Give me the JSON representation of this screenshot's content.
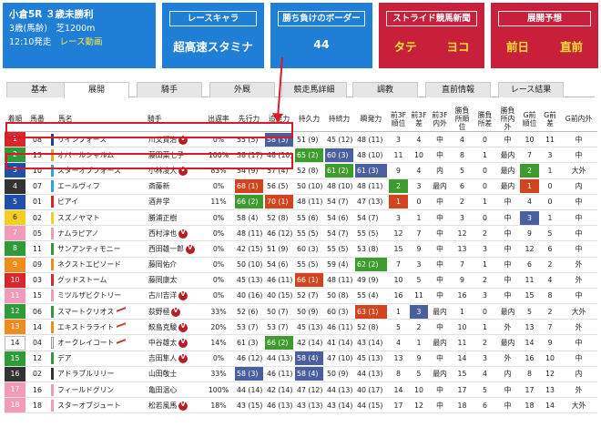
{
  "race": {
    "title": "小倉5R ３歳未勝利",
    "condition": "3歳(馬齢)　芝1200m",
    "time": "12:10発走",
    "video_link": "レース動画"
  },
  "chara": {
    "label": "レースキャラ",
    "value": "超高速スタミナ"
  },
  "border": {
    "label": "勝ち負けのボーダー",
    "value": "44"
  },
  "stride": {
    "label": "ストライド競馬新聞",
    "tate": "タテ",
    "yoko": "ヨコ"
  },
  "tenkai": {
    "label": "展開予想",
    "zenjitsu": "前日",
    "chokuzen": "直前"
  },
  "tabs": [
    "基本",
    "展開",
    "騎手",
    "外厩",
    "競走馬詳細",
    "調教",
    "直前情報",
    "レース結果"
  ],
  "active_tab": "展開",
  "columns": [
    "着順",
    "馬番",
    "馬名",
    "騎手",
    "出遅率",
    "先行力",
    "追走力",
    "持久力",
    "持続力",
    "瞬発力",
    "前3F順位",
    "前3F差",
    "前3F内外",
    "勝負所順位",
    "勝負所差",
    "勝負所内外",
    "G前順位",
    "G前差",
    "G前内外"
  ],
  "colors": {
    "panel_blue": "#1f7fd6",
    "panel_red": "#c8203a",
    "hl_red": "#d2431f",
    "hl_green": "#3e9b2d",
    "hl_blue": "#4a5f9e",
    "highlight_box": "#d81b2b"
  },
  "rows": [
    {
      "rank": "1",
      "waku": 3,
      "num": "08",
      "bar": "#1f3fa0",
      "name": "リインフォース",
      "jockey": "川又賢治",
      "mv": true,
      "dels": "0%",
      "senko": "55 (5)",
      "oiso": "58 (3)",
      "jikyu": "51 (9)",
      "jizoku": "45 (12)",
      "shunpatsu": "48 (11)",
      "f1": "3",
      "f2": "4",
      "f3": "中",
      "g1": "4",
      "g2": "0",
      "g3": "中",
      "h1": "10",
      "h2": "11",
      "h3": "中",
      "hl": {
        "oiso": "blue"
      }
    },
    {
      "rank": "2",
      "waku": 6,
      "num": "13",
      "bar": "#f0a020",
      "name": "オバールシャルム",
      "jockey": "藤田菜七子",
      "mv": false,
      "dels": "100%",
      "senko": "38 (17)",
      "oiso": "48 (10)",
      "jikyu": "65 (2)",
      "jizoku": "60 (3)",
      "shunpatsu": "48 (10)",
      "f1": "11",
      "f2": "10",
      "f3": "中",
      "g1": "8",
      "g2": "1",
      "g3": "最内",
      "h1": "7",
      "h2": "3",
      "h3": "中",
      "hl": {
        "jikyu": "green",
        "jizoku": "blue"
      }
    },
    {
      "rank": "3",
      "waku": 4,
      "num": "10",
      "bar": "#2aa4e0",
      "name": "スターオブフォース",
      "jockey": "小林凌大",
      "mv": true,
      "dels": "83%",
      "senko": "54 (9)",
      "oiso": "57 (4)",
      "jikyu": "52 (8)",
      "jizoku": "61 (2)",
      "shunpatsu": "61 (3)",
      "f1": "9",
      "f2": "4",
      "f3": "内",
      "g1": "5",
      "g2": "0",
      "g3": "最内",
      "h1": "2",
      "h2": "1",
      "h3": "大外",
      "hl": {
        "jizoku": "green",
        "shunpatsu": "blue",
        "h1": "green"
      }
    },
    {
      "rank": "4",
      "waku": 2,
      "num": "07",
      "bar": "#2aa4e0",
      "name": "エールヴィフ",
      "jockey": "斎藤新",
      "mv": false,
      "dels": "0%",
      "senko": "68 (1)",
      "oiso": "56 (5)",
      "jikyu": "50 (10)",
      "jizoku": "48 (10)",
      "shunpatsu": "48 (11)",
      "f1": "2",
      "f2": "3",
      "f3": "最内",
      "g1": "6",
      "g2": "0",
      "g3": "最内",
      "h1": "1",
      "h2": "0",
      "h3": "内",
      "hl": {
        "senko": "red",
        "f1": "green",
        "h1": "red"
      }
    },
    {
      "rank": "5",
      "waku": 4,
      "num": "01",
      "bar": "#d9262a",
      "name": "ピアイ",
      "jockey": "酒井学",
      "mv": false,
      "dels": "11%",
      "senko": "66 (2)",
      "oiso": "70 (1)",
      "jikyu": "48 (11)",
      "jizoku": "54 (7)",
      "shunpatsu": "47 (13)",
      "f1": "1",
      "f2": "0",
      "f3": "中",
      "g1": "2",
      "g2": "1",
      "g3": "中",
      "h1": "4",
      "h2": "0",
      "h3": "中",
      "hl": {
        "senko": "green",
        "oiso": "red",
        "f1": "red"
      }
    },
    {
      "rank": "6",
      "waku": 5,
      "num": "02",
      "bar": "#f3d01f",
      "name": "スズノヤマト",
      "jockey": "勝浦正樹",
      "mv": false,
      "dels": "0%",
      "senko": "58 (4)",
      "oiso": "52 (8)",
      "jikyu": "55 (6)",
      "jizoku": "54 (6)",
      "shunpatsu": "54 (7)",
      "f1": "3",
      "f2": "1",
      "f3": "中",
      "g1": "3",
      "g2": "0",
      "g3": "中",
      "h1": "3",
      "h2": "1",
      "h3": "中",
      "hl": {
        "h1": "blue"
      }
    },
    {
      "rank": "7",
      "waku": 8,
      "num": "05",
      "bar": "#f29bb8",
      "name": "ナムラピアノ",
      "jockey": "西村淳也",
      "mv": true,
      "dels": "0%",
      "senko": "48 (11)",
      "oiso": "46 (12)",
      "jikyu": "55 (5)",
      "jizoku": "54 (7)",
      "shunpatsu": "55 (5)",
      "f1": "12",
      "f2": "7",
      "f3": "中",
      "g1": "12",
      "g2": "2",
      "g3": "中",
      "h1": "9",
      "h2": "5",
      "h3": "中",
      "hl": {}
    },
    {
      "rank": "8",
      "waku": 6,
      "num": "11",
      "bar": "#2f9a38",
      "name": "サンアンティモニー",
      "jockey": "西田雄一郎",
      "mv": true,
      "dels": "0%",
      "senko": "42 (15)",
      "oiso": "51 (9)",
      "jikyu": "60 (3)",
      "jizoku": "55 (5)",
      "shunpatsu": "53 (8)",
      "f1": "15",
      "f2": "9",
      "f3": "中",
      "g1": "13",
      "g2": "3",
      "g3": "中",
      "h1": "12",
      "h2": "6",
      "h3": "中",
      "hl": {}
    },
    {
      "rank": "9",
      "waku": 7,
      "num": "09",
      "bar": "#f08c1e",
      "name": "ネクストエピソード",
      "jockey": "藤岡佑介",
      "mv": false,
      "dels": "0%",
      "senko": "50 (10)",
      "oiso": "54 (6)",
      "jikyu": "55 (5)",
      "jizoku": "59 (4)",
      "shunpatsu": "62 (2)",
      "f1": "7",
      "f2": "3",
      "f3": "中",
      "g1": "7",
      "g2": "1",
      "g3": "中",
      "h1": "6",
      "h2": "2",
      "h3": "外",
      "hl": {
        "shunpatsu": "green"
      }
    },
    {
      "rank": "10",
      "waku": 3,
      "num": "03",
      "bar": "#d9262a",
      "name": "グッドストーム",
      "jockey": "藤岡康太",
      "mv": false,
      "dels": "0%",
      "senko": "45 (13)",
      "oiso": "46 (11)",
      "jikyu": "66 (1)",
      "jizoku": "48 (11)",
      "shunpatsu": "49 (9)",
      "f1": "10",
      "f2": "5",
      "f3": "中",
      "g1": "9",
      "g2": "2",
      "g3": "中",
      "h1": "11",
      "h2": "4",
      "h3": "外",
      "hl": {
        "jikyu": "red"
      }
    },
    {
      "rank": "11",
      "waku": 8,
      "num": "15",
      "bar": "#f29bb8",
      "name": "ミツルザビクトリー",
      "jockey": "古川吉洋",
      "mv": true,
      "dels": "0%",
      "senko": "40 (16)",
      "oiso": "40 (15)",
      "jikyu": "52 (7)",
      "jizoku": "50 (8)",
      "shunpatsu": "55 (4)",
      "f1": "16",
      "f2": "11",
      "f3": "中",
      "g1": "16",
      "g2": "3",
      "g3": "中",
      "h1": "15",
      "h2": "8",
      "h3": "中",
      "hl": {}
    },
    {
      "rank": "12",
      "waku": 6,
      "num": "06",
      "bar": "#2f9a38",
      "name": "スマートクリオス",
      "jockey": "荻野極",
      "mv": true,
      "dels": "33%",
      "senko": "52 (6)",
      "oiso": "50 (7)",
      "jikyu": "50 (9)",
      "jizoku": "60 (3)",
      "shunpatsu": "63 (1)",
      "f1": "1",
      "f2": "3",
      "f3": "最内",
      "g1": "1",
      "g2": "0",
      "g3": "最内",
      "h1": "5",
      "h2": "2",
      "h3": "大外",
      "hl": {
        "shunpatsu": "red",
        "f2": "blue"
      },
      "arrow": true
    },
    {
      "rank": "13",
      "waku": 7,
      "num": "14",
      "bar": "#f08c1e",
      "name": "エキストラライト",
      "jockey": "鮫島克駿",
      "mv": true,
      "dels": "20%",
      "senko": "53 (7)",
      "oiso": "53 (7)",
      "jikyu": "45 (13)",
      "jizoku": "46 (11)",
      "shunpatsu": "52 (8)",
      "f1": "5",
      "f2": "2",
      "f3": "中",
      "g1": "10",
      "g2": "1",
      "g3": "外",
      "h1": "13",
      "h2": "7",
      "h3": "外",
      "hl": {},
      "arrow": true
    },
    {
      "rank": "14",
      "waku": 1,
      "num": "04",
      "bar": "#ffffff",
      "name": "オークレイコート",
      "jockey": "中谷雄太",
      "mv": true,
      "dels": "14%",
      "senko": "61 (3)",
      "oiso": "66 (2)",
      "jikyu": "42 (14)",
      "jizoku": "41 (14)",
      "shunpatsu": "43 (14)",
      "f1": "4",
      "f2": "1",
      "f3": "最内",
      "g1": "11",
      "g2": "2",
      "g3": "最内",
      "h1": "14",
      "h2": "9",
      "h3": "中",
      "hl": {
        "oiso": "green"
      },
      "arrow": true
    },
    {
      "rank": "15",
      "waku": 6,
      "num": "12",
      "bar": "#2f9a38",
      "name": "デア",
      "jockey": "吉田隼人",
      "mv": true,
      "dels": "0%",
      "senko": "46 (12)",
      "oiso": "44 (13)",
      "jikyu": "58 (4)",
      "jizoku": "47 (10)",
      "shunpatsu": "45 (13)",
      "f1": "13",
      "f2": "9",
      "f3": "中",
      "g1": "14",
      "g2": "3",
      "g3": "外",
      "h1": "16",
      "h2": "10",
      "h3": "中",
      "hl": {
        "jikyu": "blue"
      }
    },
    {
      "rank": "16",
      "waku": 2,
      "num": "02",
      "bar": "#333333",
      "name": "アドラブルリリー",
      "jockey": "山田敬士",
      "mv": false,
      "dels": "33%",
      "senko": "58 (3)",
      "oiso": "46 (11)",
      "jikyu": "58 (4)",
      "jizoku": "50 (9)",
      "shunpatsu": "44 (13)",
      "f1": "8",
      "f2": "5",
      "f3": "最内",
      "g1": "15",
      "g2": "4",
      "g3": "内",
      "h1": "8",
      "h2": "12",
      "h3": "内",
      "hl": {
        "senko": "blue",
        "jikyu": "blue"
      }
    },
    {
      "rank": "17",
      "waku": 8,
      "num": "16",
      "bar": "#f29bb8",
      "name": "フィールドグリン",
      "jockey": "亀田温心",
      "mv": false,
      "dels": "100%",
      "senko": "44 (14)",
      "oiso": "42 (14)",
      "jikyu": "47 (12)",
      "jizoku": "44 (13)",
      "shunpatsu": "40 (17)",
      "f1": "14",
      "f2": "10",
      "f3": "中",
      "g1": "17",
      "g2": "5",
      "g3": "中",
      "h1": "17",
      "h2": "13",
      "h3": "外",
      "hl": {}
    },
    {
      "rank": "18",
      "waku": 8,
      "num": "18",
      "bar": "#f29bb8",
      "name": "スターオブジュート",
      "jockey": "松若風馬",
      "mv": true,
      "dels": "18%",
      "senko": "43 (15)",
      "oiso": "46 (13)",
      "jikyu": "43 (13)",
      "jizoku": "43 (14)",
      "shunpatsu": "44 (15)",
      "f1": "17",
      "f2": "12",
      "f3": "中",
      "g1": "18",
      "g2": "6",
      "g3": "中",
      "h1": "18",
      "h2": "14",
      "h3": "大外",
      "hl": {}
    }
  ]
}
